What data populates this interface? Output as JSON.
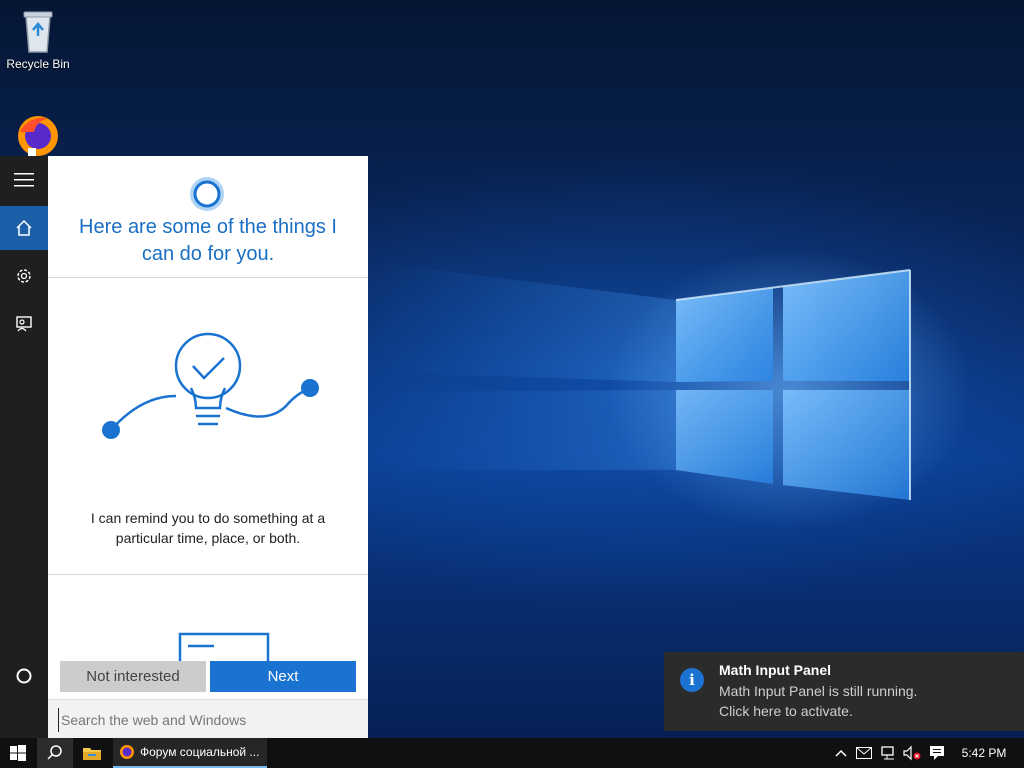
{
  "desktop": {
    "recycle_bin_label": "Recycle Bin"
  },
  "cortana": {
    "headline": "Here are some of the things I can do for you.",
    "tip_text": "I can remind you to do something at a particular time, place, or both.",
    "not_interested_label": "Not interested",
    "next_label": "Next",
    "search_placeholder": "Search the web and Windows"
  },
  "toast": {
    "title": "Math Input Panel",
    "line1": "Math Input Panel is still running.",
    "line2": "Click here to activate.",
    "icon_glyph": "i"
  },
  "taskbar": {
    "firefox_window_label": "Форум социальной ...",
    "clock": "5:42 PM"
  },
  "colors": {
    "accent": "#1a73d0",
    "cortana_text": "#1a6fc4",
    "rail": "#1f1f1f",
    "taskbar": "#101010"
  },
  "icons": [
    "recycle-bin-icon",
    "firefox-icon",
    "hamburger-icon",
    "home-icon",
    "gear-icon",
    "feedback-icon",
    "cortana-circle-icon",
    "windows-logo-icon",
    "search-icon",
    "file-explorer-icon",
    "chevron-up-icon",
    "message-icon",
    "network-icon",
    "volume-muted-icon",
    "action-center-icon",
    "info-icon"
  ]
}
